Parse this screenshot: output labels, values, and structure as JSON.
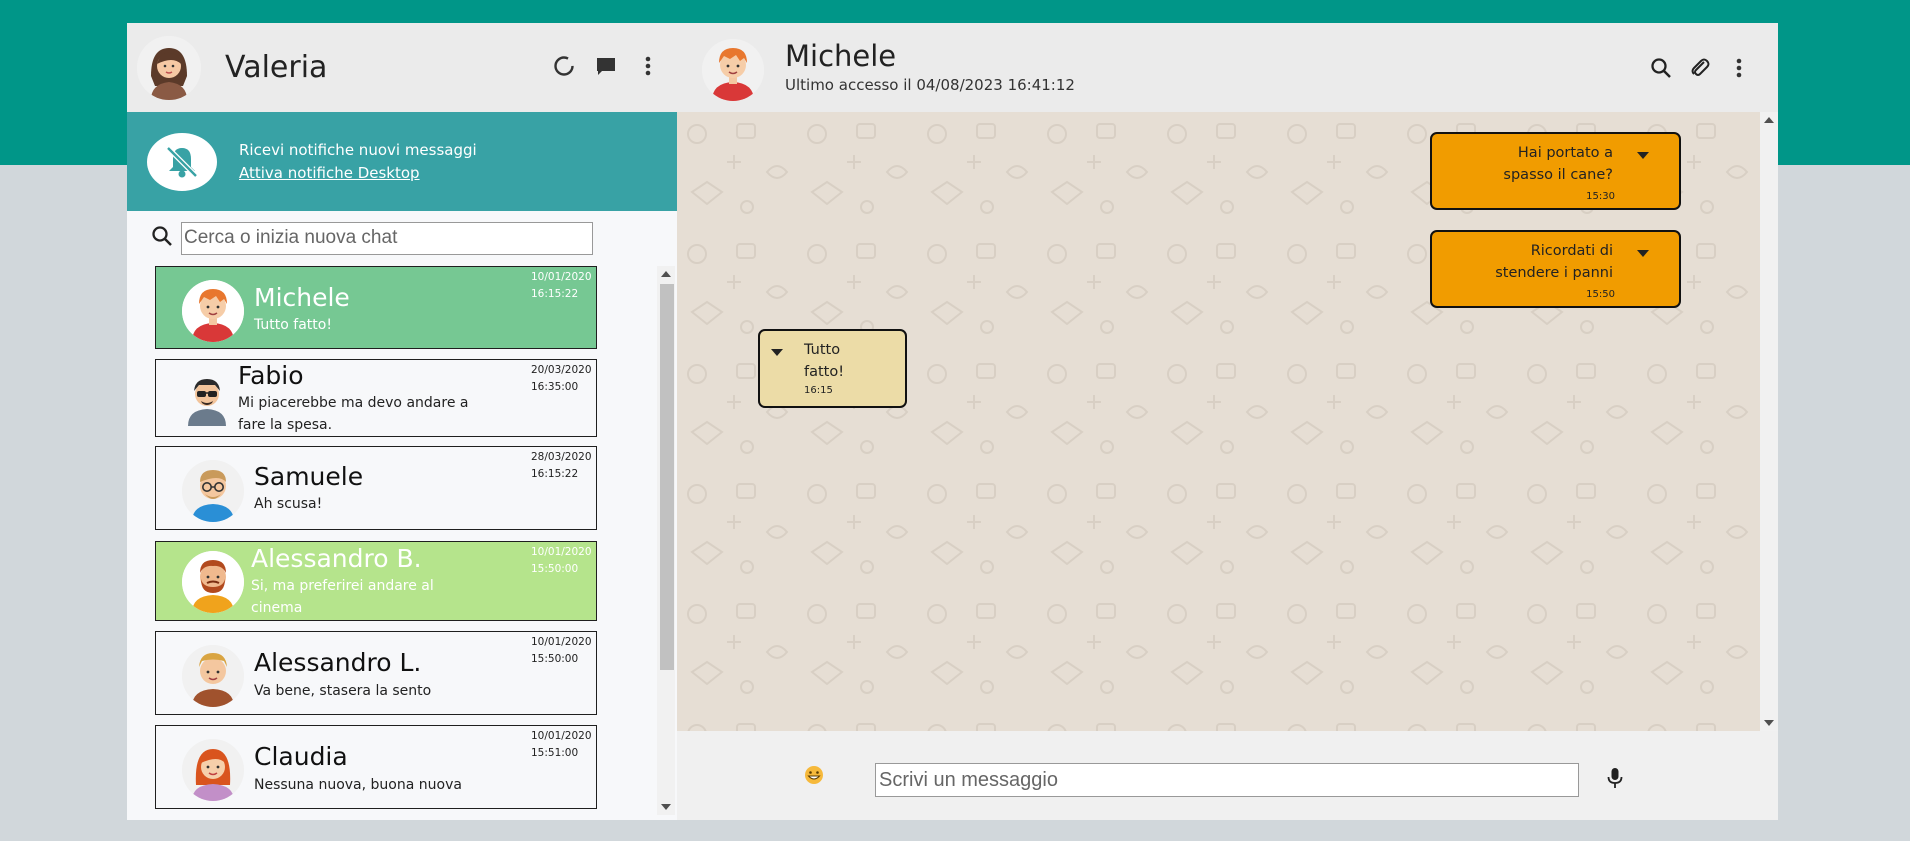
{
  "colors": {
    "brand_band": "#009688",
    "notification_bar": "#38a2a5",
    "active_contact": "#76c893",
    "highlight_contact": "#b5e48c",
    "sent_bubble": "#f19c00",
    "received_bubble": "#ecdca7",
    "chat_background": "#e6ded4"
  },
  "user": {
    "name": "Valeria",
    "avatar": "woman-avatar"
  },
  "header_icons": [
    "status-icon",
    "new-chat-icon",
    "menu-icon"
  ],
  "notifications": {
    "title": "Ricevi notifiche nuovi messaggi",
    "link": "Attiva notifiche Desktop",
    "icon": "bell-slash-icon"
  },
  "search": {
    "placeholder": "Cerca o inizia nuova chat",
    "value": ""
  },
  "contacts": [
    {
      "name": "Michele",
      "last_message": "Tutto fatto!",
      "date": "10/01/2020",
      "time": "16:15:22",
      "state": "active",
      "avatar": "red-hair-boy-avatar"
    },
    {
      "name": "Fabio",
      "last_message": "Mi piacerebbe ma devo andare a fare la spesa.",
      "date": "20/03/2020",
      "time": "16:35:00",
      "state": "normal",
      "avatar": "sunglasses-man-avatar"
    },
    {
      "name": "Samuele",
      "last_message": "Ah scusa!",
      "date": "28/03/2020",
      "time": "16:15:22",
      "state": "normal",
      "avatar": "glasses-man-avatar"
    },
    {
      "name": "Alessandro B.",
      "last_message": "Si, ma preferirei andare al cinema",
      "date": "10/01/2020",
      "time": "15:50:00",
      "state": "highlight",
      "avatar": "bearded-man-avatar"
    },
    {
      "name": "Alessandro L.",
      "last_message": "Va bene, stasera la sento",
      "date": "10/01/2020",
      "time": "15:50:00",
      "state": "normal",
      "avatar": "blond-man-avatar"
    },
    {
      "name": "Claudia",
      "last_message": "Nessuna nuova, buona nuova",
      "date": "10/01/2020",
      "time": "15:51:00",
      "state": "normal",
      "avatar": "red-hair-woman-avatar"
    }
  ],
  "chat": {
    "contact_name": "Michele",
    "last_seen": "Ultimo accesso il 04/08/2023 16:41:12",
    "header_icons": [
      "search-icon",
      "paperclip-icon",
      "menu-icon"
    ],
    "messages": [
      {
        "text": "Hai portato a spasso il cane?",
        "time": "15:30",
        "direction": "sent"
      },
      {
        "text": "Ricordati di stendere i panni",
        "time": "15:50",
        "direction": "sent"
      },
      {
        "text": "Tutto fatto!",
        "time": "16:15",
        "direction": "received"
      }
    ]
  },
  "composer": {
    "placeholder": "Scrivi un messaggio",
    "value": "",
    "emoji_icon": "grinning-face-icon",
    "mic_icon": "microphone-icon"
  }
}
